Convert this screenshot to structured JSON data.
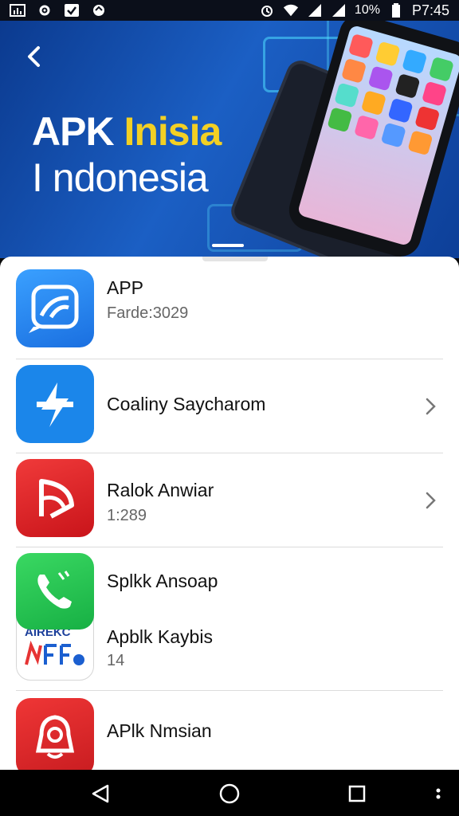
{
  "status_bar": {
    "battery": "10%",
    "time": "P7:45"
  },
  "banner": {
    "headline_word1": "APK",
    "headline_accent": "Inisia",
    "headline_line2": "I ndonesia"
  },
  "apps": [
    {
      "title": "APP",
      "subtitle": "Farde:3029",
      "icon": "chart-chat-icon",
      "color": "#1e7ff0"
    },
    {
      "title": "Coaliny Saycharom",
      "subtitle": "",
      "icon": "flash-icon",
      "color": "#1b86ea",
      "chevron": true
    },
    {
      "title": "Ralok Anwiar",
      "subtitle": "1:289",
      "icon": "play-arc-icon",
      "color": "#e41f25",
      "chevron": true
    },
    {
      "title": "Splkk Ansoap",
      "subtitle": "",
      "icon": "phone-icon",
      "color": "#1fc44b"
    },
    {
      "title": "Apblk Kaybis",
      "subtitle": "14",
      "icon": "aircraft-logo-icon",
      "color": "#ffffff",
      "badge": "AIREKC"
    },
    {
      "title": "APlk Nmsian",
      "subtitle": "",
      "icon": "bell-face-icon",
      "color": "#e02428"
    }
  ],
  "nav": {
    "back": "back-icon",
    "home": "home-icon",
    "recents": "recents-icon",
    "menu": "more-icon"
  }
}
